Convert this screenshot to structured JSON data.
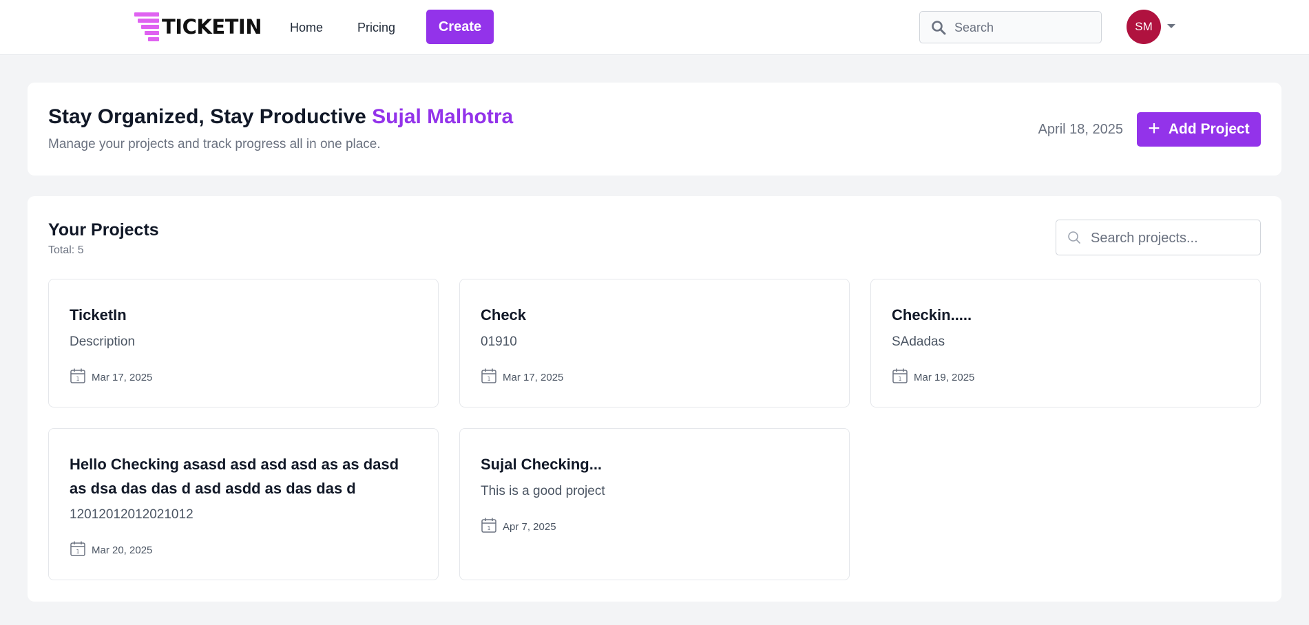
{
  "nav": {
    "logo_text": "TICKETIN",
    "links": [
      "Home",
      "Pricing"
    ],
    "create_label": "Create",
    "search_placeholder": "Search",
    "avatar_initials": "SM"
  },
  "header": {
    "title_prefix": "Stay Organized, Stay Productive",
    "user_name": "Sujal Malhotra",
    "subtitle": "Manage your projects and track progress all in one place.",
    "date": "April 18, 2025",
    "add_project_label": "Add Project"
  },
  "projects": {
    "title": "Your Projects",
    "total": "Total: 5",
    "search_placeholder": "Search projects...",
    "items": [
      {
        "title": "TicketIn",
        "description": "Description",
        "date": "Mar 17, 2025"
      },
      {
        "title": "Check",
        "description": "01910",
        "date": "Mar 17, 2025"
      },
      {
        "title": "Checkin.....",
        "description": "SAdadas",
        "date": "Mar 19, 2025"
      },
      {
        "title": "Hello Checking asasd asd asd asd as as dasd as dsa das das d asd asdd as das das d",
        "description": "12012012012021012",
        "date": "Mar 20, 2025"
      },
      {
        "title": "Sujal Checking...",
        "description": "This is a good project",
        "date": "Apr 7, 2025"
      }
    ]
  },
  "colors": {
    "accent": "#9333ea",
    "avatar": "#b0123f",
    "logo": "#d946ef"
  },
  "icons": {
    "search": "search-icon",
    "calendar": "calendar-icon",
    "plus": "plus-icon",
    "caret": "caret-down-icon"
  }
}
